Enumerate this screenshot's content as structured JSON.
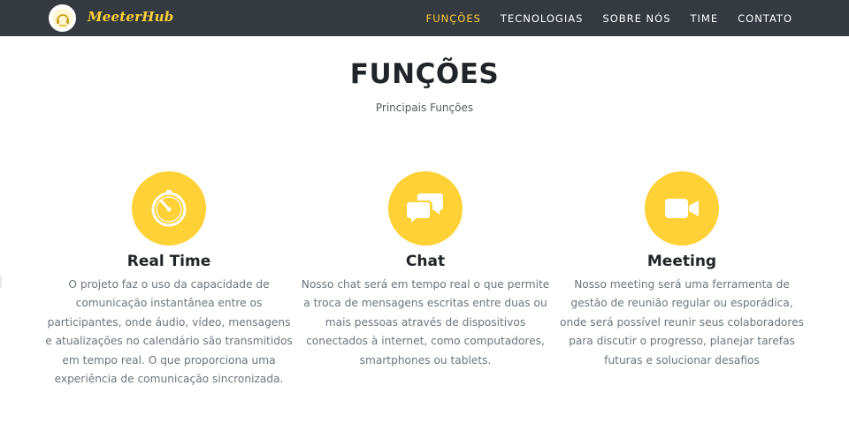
{
  "navbar": {
    "brand": "MeeterHub",
    "logo_icon": "headphones-logo-icon",
    "links": [
      {
        "label": "FUNÇÕES",
        "active": true
      },
      {
        "label": "TECNOLOGIAS",
        "active": false
      },
      {
        "label": "SOBRE NÓS",
        "active": false
      },
      {
        "label": "TIME",
        "active": false
      },
      {
        "label": "CONTATO",
        "active": false
      }
    ]
  },
  "section": {
    "title": "FUNÇÕES",
    "subtitle": "Principais Funções"
  },
  "features": [
    {
      "icon": "stopwatch-icon",
      "title": "Real Time",
      "text": "O projeto faz o uso da capacidade de comunicação instantânea entre os participantes, onde áudio, vídeo, mensagens e atualizações no calendário são transmitidos em tempo real. O que proporciona uma experiência de comunicação sincronizada."
    },
    {
      "icon": "chat-bubbles-icon",
      "title": "Chat",
      "text": "Nosso chat será em tempo real o que permite a troca de mensagens escritas entre duas ou mais pessoas através de dispositivos conectados à internet, como computadores, smartphones ou tablets."
    },
    {
      "icon": "video-camera-icon",
      "title": "Meeting",
      "text": "Nosso meeting será uma ferramenta de gestão de reunião regular ou esporádica, onde será possível reunir seus colaboradores para discutir o progresso, planejar tarefas futuras e solucionar desafios"
    }
  ],
  "colors": {
    "accent": "#fed136",
    "navbar_bg": "#343a40",
    "heading": "#212529",
    "body_text": "#6c757d"
  }
}
